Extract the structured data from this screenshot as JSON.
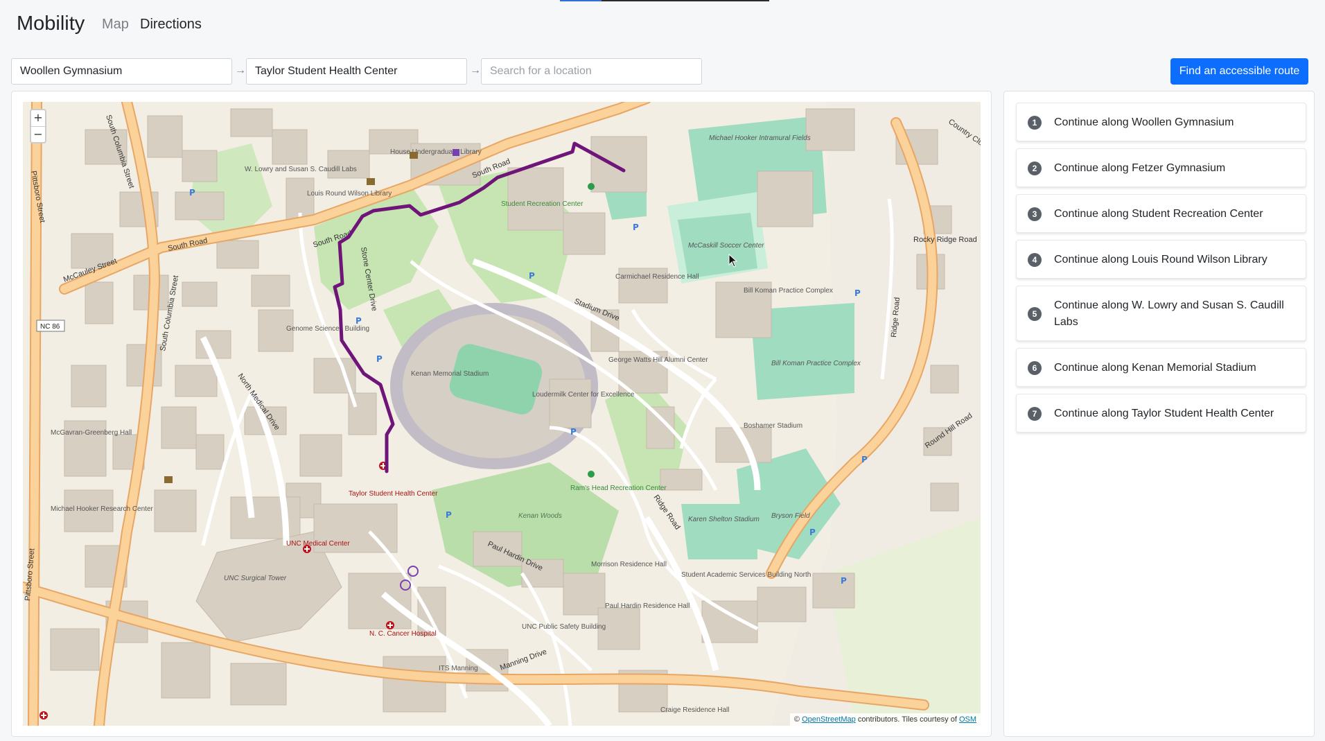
{
  "app": {
    "title": "Mobility"
  },
  "nav": {
    "map": "Map",
    "directions": "Directions"
  },
  "route_form": {
    "from_value": "Woollen Gymnasium",
    "to_value": "Taylor Student Health Center",
    "search_placeholder": "Search for a location",
    "arrow_glyph": "→",
    "find_button": "Find an accessible route"
  },
  "map": {
    "zoom_in": "+",
    "zoom_out": "−",
    "attribution": {
      "prefix": "©",
      "osm_link": "OpenStreetMap",
      "middle": "contributors. Tiles courtesy of",
      "osm_short": "OSM"
    },
    "colors": {
      "route": "#6f1479",
      "road_major": "#f7c68a",
      "road_minor": "#ffffff",
      "green": "#c7e5b2",
      "field": "#9fdcc0",
      "building": "#d8cfc3"
    },
    "labels": {
      "south_road": "South Road",
      "mccauley_street": "McCauley Street",
      "south_columbia_street": "South Columbia Street",
      "pittsboro_street": "Pittsboro Street",
      "stadium_drive": "Stadium Drive",
      "ridge_road": "Ridge Road",
      "manning_drive": "Manning Drive",
      "paul_hardin_drive": "Paul Hardin Drive",
      "north_medical_drive": "North Medical Drive",
      "stone_center_drive": "Stone Center Drive",
      "rocky_ridge_road": "Rocky Ridge Road",
      "round_hill_road": "Round Hill Road",
      "country_club": "Country Clu",
      "kenan_memorial_stadium": "Kenan Memorial Stadium",
      "loudermilk_center": "Loudermilk Center for Excellence",
      "kenan_woods": "Kenan Woods",
      "unc_medical_center": "UNC Medical Center",
      "unc_surgical_tower": "UNC Surgical Tower",
      "cancer_hospital": "N. C. Cancer Hospital",
      "taylor_health_center": "Taylor Student Health Center",
      "mccaskill_soccer": "McCaskill Soccer Center",
      "bill_koman_complex": "Bill Koman Practice Complex",
      "bryson_field": "Bryson Field",
      "karen_shelton_stadium": "Karen Shelton Stadium",
      "boshamer_stadium": "Boshamer Stadium",
      "fetzer_gym": "Michael Hooker Intramural Fields",
      "house_library": "House Undergraduate Library",
      "wilson_library": "Louis Round Wilson Library",
      "caudill_labs": "W. Lowry and Susan S. Caudill Labs",
      "student_rec": "Student Recreation Center",
      "rams_head_rec": "Ram's Head Recreation Center",
      "genome_sciences": "Genome Sciences Building",
      "carmichael_hall": "Carmichael Residence Hall",
      "george_watts_hill": "George Watts Hill Alumni Center",
      "its_manning": "ITS Manning",
      "unc_public_safety": "UNC Public Safety Building",
      "morrison_hall": "Morrison Residence Hall",
      "hardin_hall": "Paul Hardin Residence Hall",
      "craige_hall": "Craige Residence Hall",
      "student_academic_services": "Student Academic Services Building North",
      "mcgavran_greenberg": "McGavran-Greenberg Hall",
      "michael_hooker_research": "Michael Hooker Research Center",
      "nc86": "NC 86"
    }
  },
  "steps": [
    {
      "num": "1",
      "text": "Continue along Woollen Gymnasium"
    },
    {
      "num": "2",
      "text": "Continue along Fetzer Gymnasium"
    },
    {
      "num": "3",
      "text": "Continue along Student Recreation Center"
    },
    {
      "num": "4",
      "text": "Continue along Louis Round Wilson Library"
    },
    {
      "num": "5",
      "text": "Continue along W. Lowry and Susan S. Caudill Labs"
    },
    {
      "num": "6",
      "text": "Continue along Kenan Memorial Stadium"
    },
    {
      "num": "7",
      "text": "Continue along Taylor Student Health Center"
    }
  ]
}
